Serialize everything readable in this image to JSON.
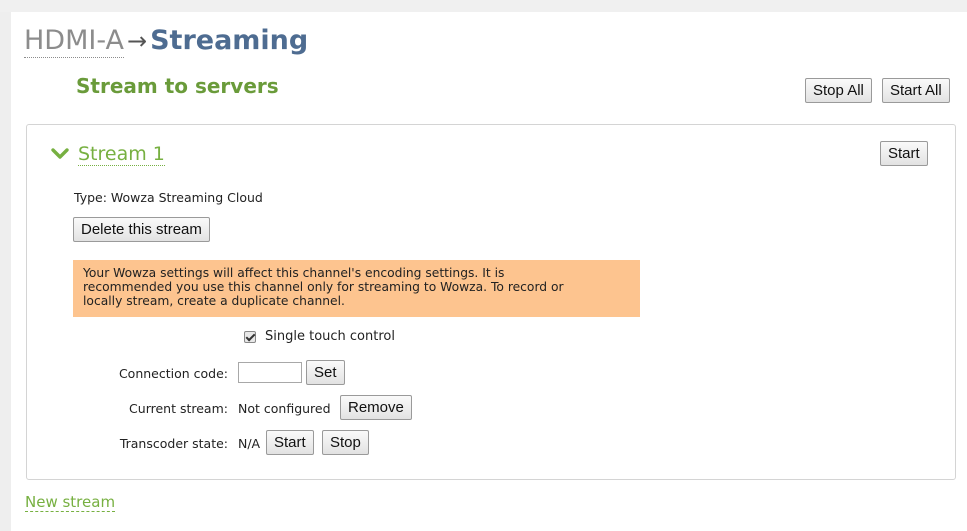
{
  "breadcrumb": {
    "parent": "HDMI-A",
    "arrow": "→",
    "current": "Streaming"
  },
  "section": {
    "title": "Stream to servers",
    "stop_all_label": "Stop All",
    "start_all_label": "Start All"
  },
  "stream": {
    "name": "Stream 1",
    "start_label": "Start",
    "type_text": "Type: Wowza Streaming Cloud",
    "delete_label": "Delete this stream",
    "warning_lines": [
      "Your Wowza settings will affect this channel's encoding settings. It is",
      "recommended you use this channel only for streaming to Wowza. To record or",
      "locally stream, create a duplicate channel."
    ],
    "single_touch_label": "Single touch control",
    "single_touch_checked": true,
    "connection_code_label": "Connection code:",
    "connection_code_value": "",
    "set_label": "Set",
    "current_stream_label": "Current stream:",
    "current_stream_value": "Not configured",
    "remove_label": "Remove",
    "transcoder_label": "Transcoder state:",
    "transcoder_value": "N/A",
    "transcoder_start_label": "Start",
    "transcoder_stop_label": "Stop"
  },
  "new_stream_label": "New stream",
  "colors": {
    "accent_green": "#77b041",
    "title_green": "#6a9b3a",
    "breadcrumb_blue": "#4e6c91",
    "warning_bg": "#fdc48f"
  },
  "icons": {
    "chevron": "chevron-down-icon",
    "checkbox": "checkbox-checked"
  }
}
